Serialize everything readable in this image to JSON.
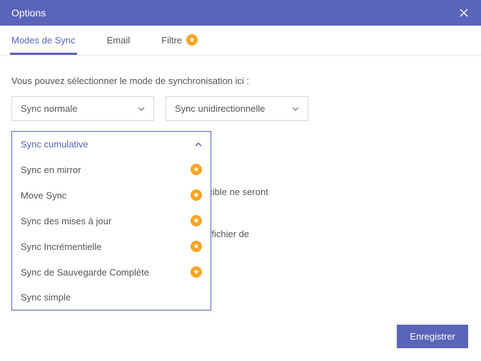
{
  "header": {
    "title": "Options"
  },
  "tabs": {
    "items": [
      {
        "label": "Modes de Sync",
        "starred": false,
        "active": true
      },
      {
        "label": "Email",
        "starred": false,
        "active": false
      },
      {
        "label": "Filtre",
        "starred": true,
        "active": false
      }
    ]
  },
  "content": {
    "description": "Vous pouvez sélectionner le mode de synchronisation ici :",
    "select1": {
      "value": "Sync normale"
    },
    "select2": {
      "value": "Sync unidirectionnelle"
    },
    "body_line1": "ertoire source, les mêmes fichiers du répertoire cible ne seront",
    "body_line2": "iers avec des caractères spéciaux et générer un fichier de"
  },
  "dropdown": {
    "selected": "Sync cumulative",
    "items": [
      {
        "label": "Sync en mirror",
        "starred": true
      },
      {
        "label": "Move Sync",
        "starred": true
      },
      {
        "label": "Sync des mises à jour",
        "starred": true
      },
      {
        "label": "Sync Incrémentielle",
        "starred": true
      },
      {
        "label": "Sync de Sauvegarde Complète",
        "starred": true
      },
      {
        "label": "Sync simple",
        "starred": false
      }
    ]
  },
  "footer": {
    "save_label": "Enregistrer"
  }
}
